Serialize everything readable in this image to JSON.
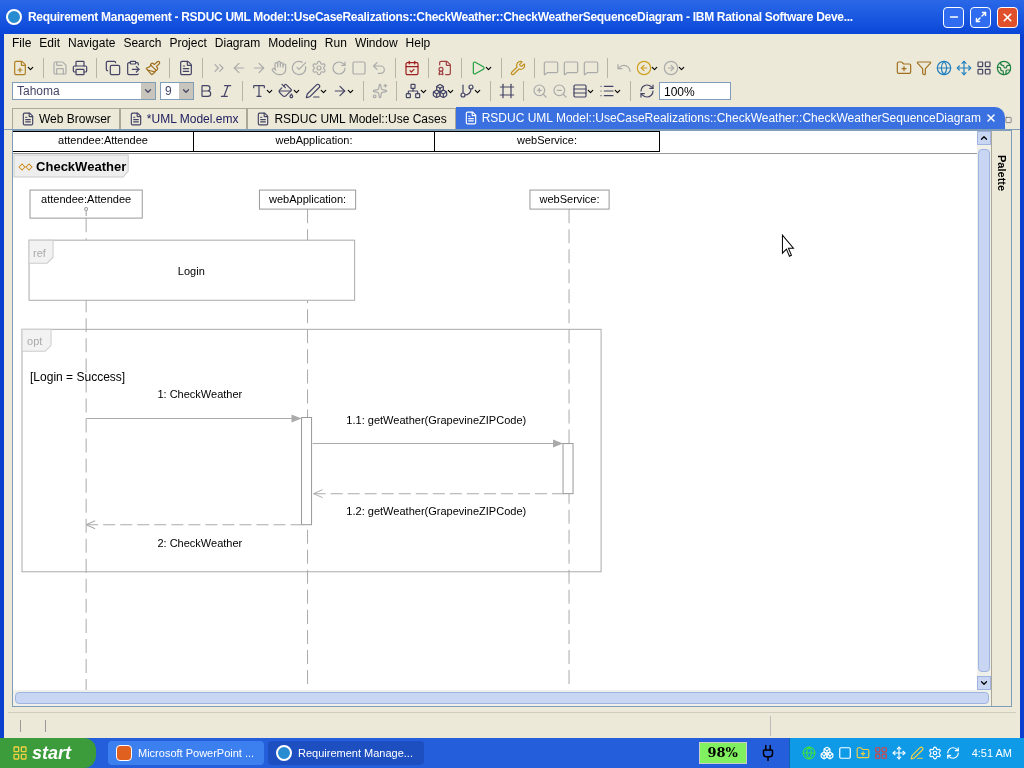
{
  "window": {
    "title": "Requirement Management - RSDUC UML Model::UseCaseRealizations::CheckWeather::CheckWeatherSequenceDiagram - IBM Rational Software Deve..."
  },
  "menu": [
    "File",
    "Edit",
    "Navigate",
    "Search",
    "Project",
    "Diagram",
    "Modeling",
    "Run",
    "Window",
    "Help"
  ],
  "format_bar": {
    "font": "Tahoma",
    "size": "9",
    "zoom": "100%"
  },
  "tabs": [
    {
      "label": "Web Browser",
      "selected": false,
      "dirty": false
    },
    {
      "label": "*UML Model.emx",
      "selected": false,
      "dirty": true
    },
    {
      "label": "RSDUC UML Model::Use Cases",
      "selected": false,
      "dirty": false
    },
    {
      "label": "RSDUC UML Model::UseCaseRealizations::CheckWeather::CheckWeatherSequenceDiagram",
      "selected": true,
      "dirty": false
    }
  ],
  "lifeline_header": [
    "attendee:Attendee",
    "webApplication:",
    "webService:"
  ],
  "diagram": {
    "title": "CheckWeather",
    "lifelines": [
      {
        "name": "attendee:Attendee",
        "kind": "actor"
      },
      {
        "name": "webApplication:",
        "kind": "object"
      },
      {
        "name": "webService:",
        "kind": "object"
      }
    ],
    "ref": {
      "tag": "ref",
      "text": "Login"
    },
    "opt": {
      "tag": "opt",
      "guard": "[Login = Success]"
    },
    "messages": [
      {
        "kind": "call",
        "label": "1: CheckWeather"
      },
      {
        "kind": "call",
        "label": "1.1: getWeather(GrapevineZIPCode)"
      },
      {
        "kind": "reply",
        "label": "1.2: getWeather(GrapevineZIPCode)"
      },
      {
        "kind": "reply",
        "label": "2: CheckWeather"
      }
    ]
  },
  "palette": {
    "label": "Palette"
  },
  "taskbar": {
    "start": "start",
    "tasks": [
      {
        "label": "Microsoft PowerPoint ...",
        "selected": false,
        "kind": "powerpoint"
      },
      {
        "label": "Requirement Manage...",
        "selected": true,
        "kind": "eclipse"
      }
    ],
    "battery": "98%",
    "clock": "4:51 AM"
  }
}
